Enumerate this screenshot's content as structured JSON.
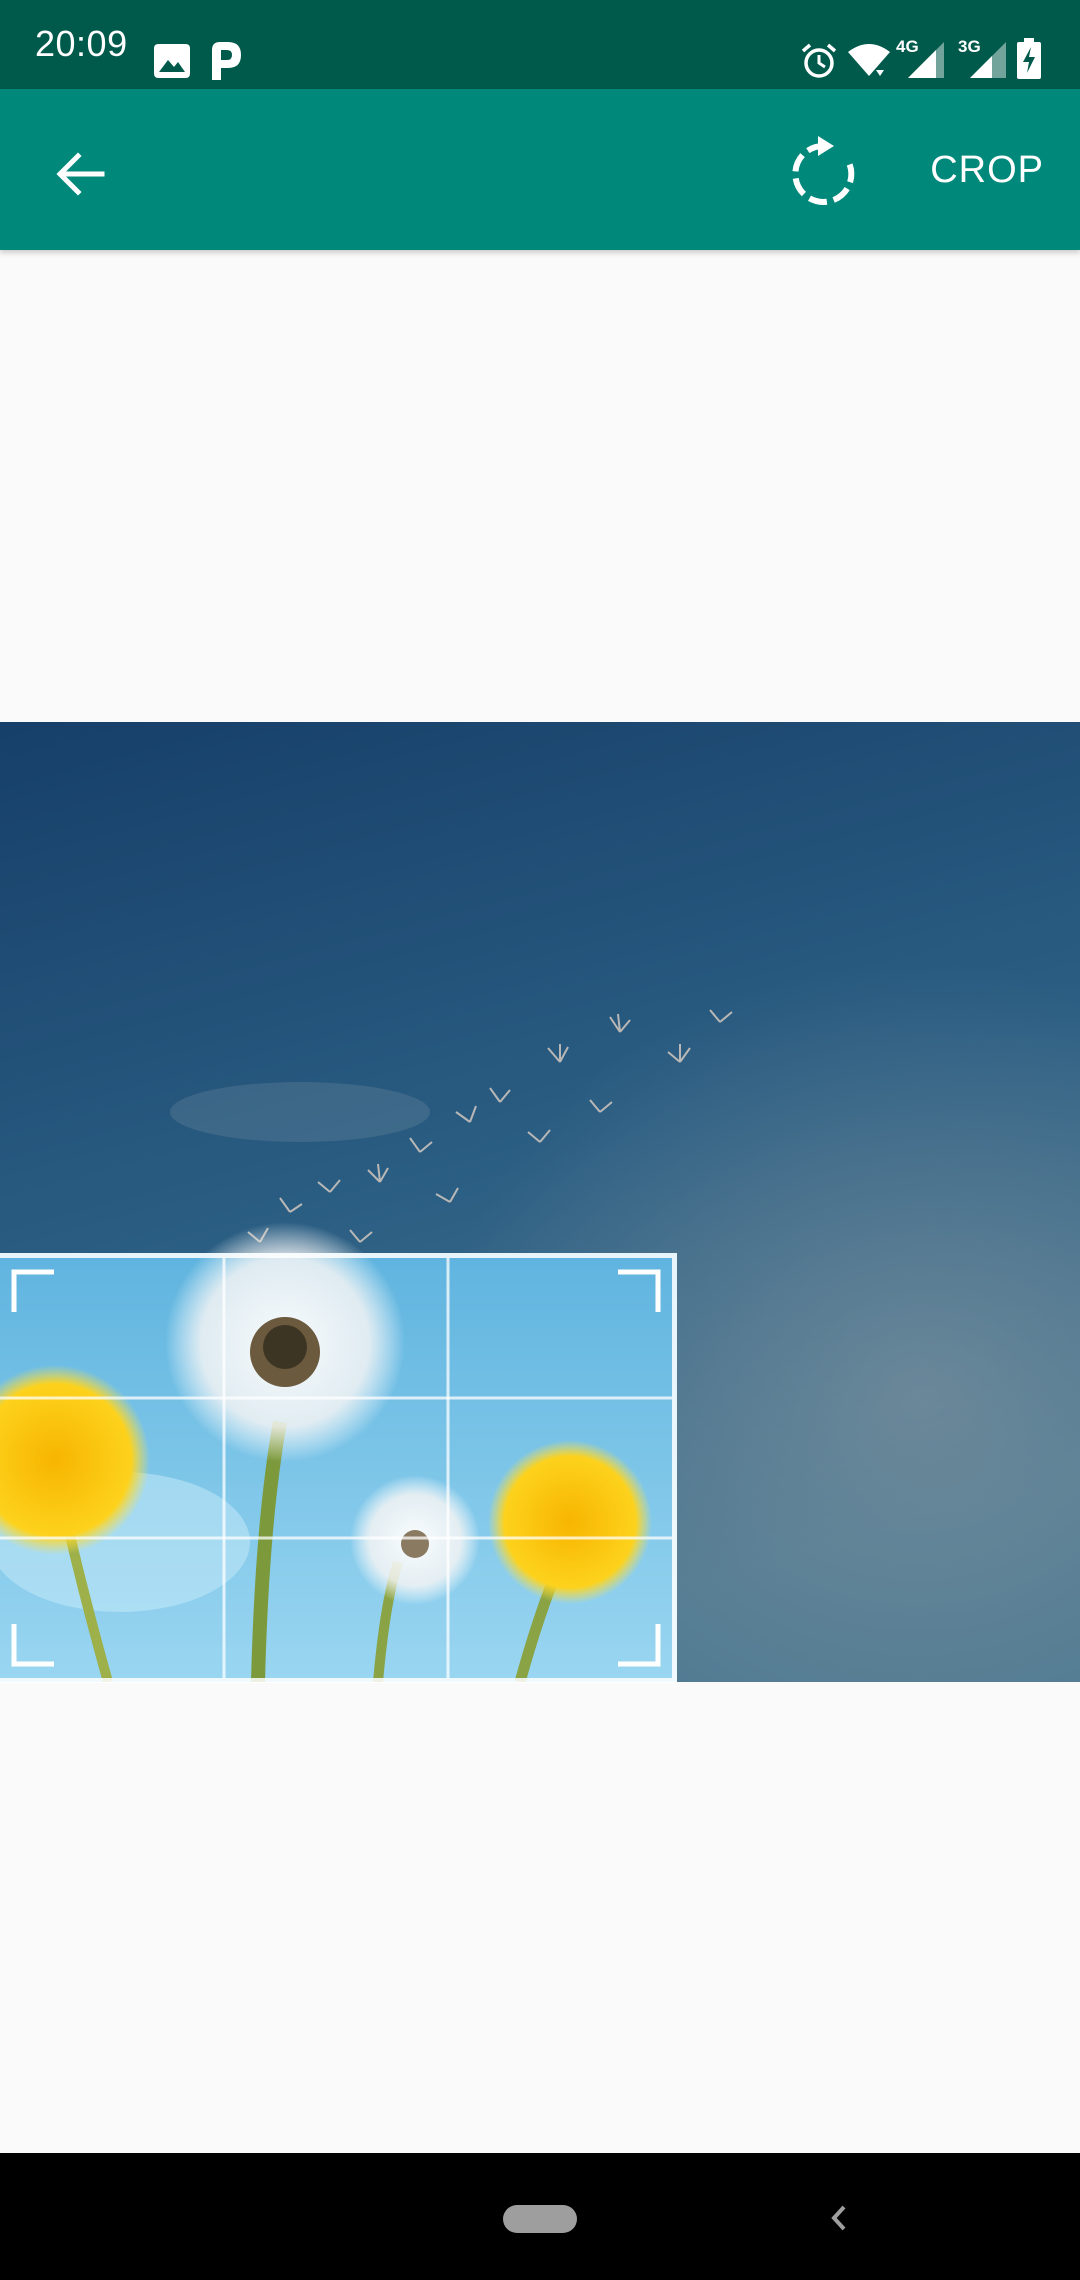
{
  "status_bar": {
    "time": "20:09",
    "left_icons": [
      "image-icon",
      "parking-icon"
    ],
    "right_icons": [
      "alarm-icon",
      "wifi-icon",
      "signal-4g-icon",
      "signal-3g-icon",
      "battery-charging-icon"
    ],
    "network_labels": [
      "4G",
      "3G"
    ]
  },
  "toolbar": {
    "back_icon": "arrow-back-icon",
    "rotate_icon": "rotate-icon",
    "crop_label": "CROP",
    "background_color": "#00887a"
  },
  "photo": {
    "subject": "dandelions-against-blue-sky"
  },
  "crop_overlay": {
    "grid": "3x3",
    "frame_color": "#ffffff"
  },
  "nav_bar": {
    "home_icon": "home-pill-icon",
    "back_icon": "nav-back-icon"
  }
}
